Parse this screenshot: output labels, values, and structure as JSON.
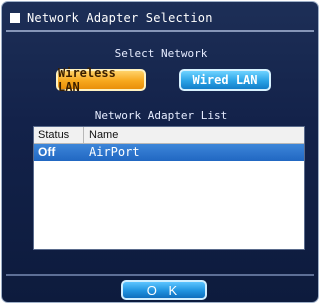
{
  "dialog": {
    "title": "Network Adapter Selection",
    "select_network_label": "Select Network",
    "wireless_button": "Wireless LAN",
    "wired_button": "Wired LAN",
    "adapter_list_label": "Network Adapter List",
    "ok_button": "O K"
  },
  "adapter_list": {
    "columns": [
      "Status",
      "Name"
    ],
    "rows": [
      {
        "status": "Off",
        "name": "AirPort",
        "selected": true
      }
    ]
  },
  "colors": {
    "background": "#13224a",
    "wireless_button": "#f7a81d",
    "wired_button": "#2aa3e6",
    "selection": "#2a72c9"
  }
}
